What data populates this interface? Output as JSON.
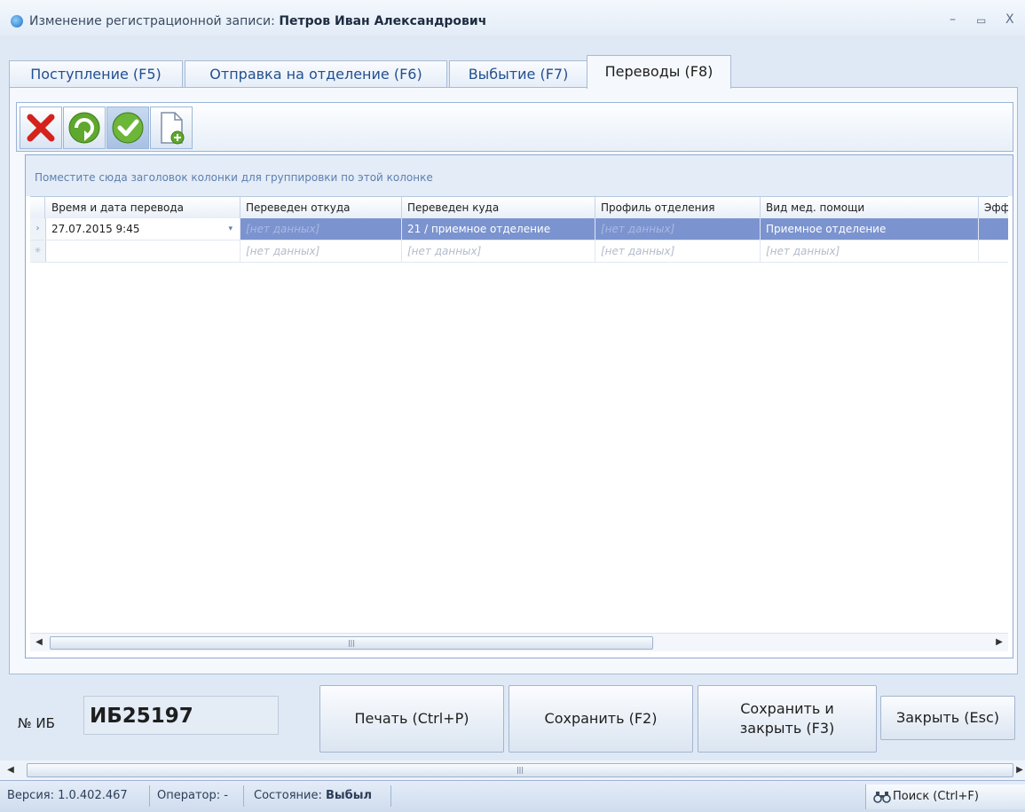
{
  "window": {
    "title_prefix": "Изменение регистрационной записи:",
    "title_patient": "Петров Иван Александрович",
    "minimize": "–",
    "maximize": "▭",
    "close": "X"
  },
  "tabs": [
    {
      "label": "Поступление (F5)",
      "active": false
    },
    {
      "label": "Отправка на отделение (F6)",
      "active": false
    },
    {
      "label": "Выбытие (F7)",
      "active": false
    },
    {
      "label": "Переводы (F8)",
      "active": true
    }
  ],
  "toolbar": {
    "buttons": [
      {
        "icon": "delete-x-icon"
      },
      {
        "icon": "refresh-icon"
      },
      {
        "icon": "confirm-check-icon"
      },
      {
        "icon": "new-document-icon"
      }
    ]
  },
  "grid": {
    "group_hint": "Поместите сюда заголовок колонки для группировки по этой колонке",
    "columns": [
      "Время и дата перевода",
      "Переведен откуда",
      "Переведен куда",
      "Профиль отделения",
      "Вид мед. помощи",
      "Эфф"
    ],
    "rows": [
      {
        "datetime": "27.07.2015 9:45",
        "from": "[нет данных]",
        "to": "21 / приемное отделение",
        "profile": "[нет данных]",
        "care_type": "Приемное отделение",
        "selected": true
      },
      {
        "datetime": "",
        "from": "[нет данных]",
        "to": "[нет данных]",
        "profile": "[нет данных]",
        "care_type": "[нет данных]",
        "new_row": true
      }
    ],
    "scroll_grip": "|||"
  },
  "footer": {
    "ib_label": "№ ИБ",
    "ib_number": "ИБ25197",
    "print_button": "Печать (Ctrl+P)",
    "save_button": "Сохранить (F2)",
    "save_close_line1": "Сохранить и",
    "save_close_line2": "закрыть (F3)",
    "close_button": "Закрыть (Esc)"
  },
  "statusbar": {
    "version": "Версия: 1.0.402.467",
    "operator": "Оператор: -",
    "state_label": "Состояние:",
    "state_value": "Выбыл",
    "search": "Поиск (Ctrl+F)"
  },
  "colors": {
    "selection": "#7b93cf",
    "accent": "#23508f",
    "background": "#dfe9f5"
  }
}
